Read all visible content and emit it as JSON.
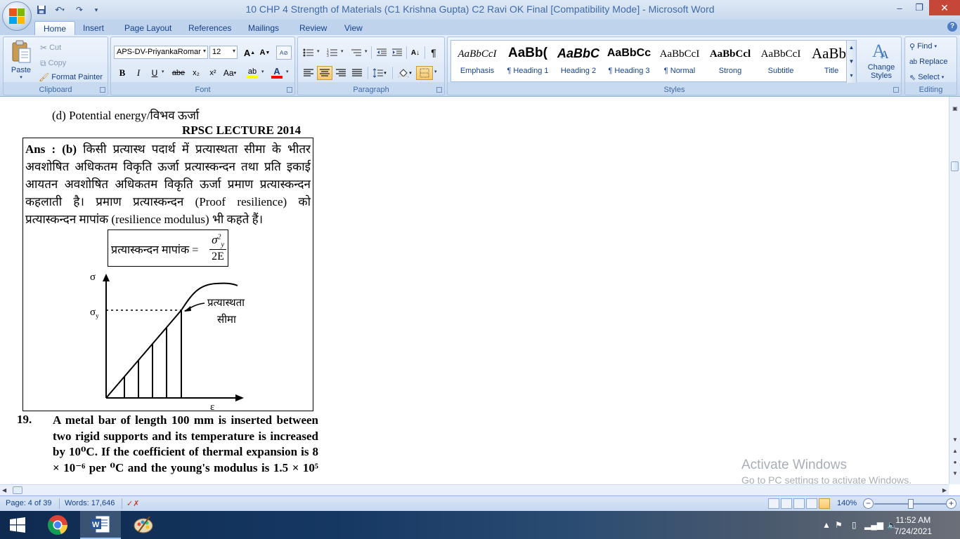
{
  "window": {
    "title": "10 CHP 4 Strength of Materials (C1 Krishna Gupta) C2 Ravi OK Final [Compatibility Mode] - Microsoft Word",
    "minimize": "–",
    "maximize": "❐",
    "close": "✕"
  },
  "tabs": [
    "Home",
    "Insert",
    "Page Layout",
    "References",
    "Mailings",
    "Review",
    "View"
  ],
  "ribbon": {
    "clipboard": {
      "label": "Clipboard",
      "paste": "Paste",
      "cut": "Cut",
      "copy": "Copy",
      "format_painter": "Format Painter"
    },
    "font": {
      "label": "Font",
      "font_name": "APS-DV-PriyankaRomar",
      "font_size": "12",
      "grow": "A",
      "shrink": "A",
      "bold": "B",
      "italic": "I",
      "underline": "U",
      "strike": "abe",
      "subscript": "x₂",
      "superscript": "x²",
      "change_case": "Aa",
      "font_color_letter": "A",
      "highlight_letter": "ab"
    },
    "paragraph": {
      "label": "Paragraph",
      "pilcrow": "¶"
    },
    "styles": {
      "label": "Styles",
      "items": [
        {
          "sample": "AaBbCcI",
          "name": "Emphasis"
        },
        {
          "sample": "AaBb(",
          "name": "¶ Heading 1"
        },
        {
          "sample": "AaBbC",
          "name": "Heading 2"
        },
        {
          "sample": "AaBbCc",
          "name": "¶ Heading 3"
        },
        {
          "sample": "AaBbCcI",
          "name": "¶ Normal"
        },
        {
          "sample": "AaBbCcl",
          "name": "Strong"
        },
        {
          "sample": "AaBbCcI",
          "name": "Subtitle"
        },
        {
          "sample": "AaBb(",
          "name": "Title"
        }
      ],
      "change_styles": "Change Styles"
    },
    "editing": {
      "label": "Editing",
      "find": "Find",
      "replace": "Replace",
      "select": "Select"
    }
  },
  "document": {
    "option_d": "(d)   Potential energy/विभव ऊर्जा",
    "source": "RPSC LECTURE 2014",
    "answer_prefix": "Ans : (b)",
    "answer_text": " किसी प्रत्यास्थ पदार्थ में प्रत्यास्थता सीमा के भीतर अवशोषित अधिकतम विकृति ऊर्जा प्रत्यास्कन्दन तथा प्रति इकाई आयतन अवशोषित अधिकतम विकृति ऊर्जा प्रमाण प्रत्यास्कन्दन कहलाती है। प्रमाण प्रत्यास्कन्दन (Proof resilience) को प्रत्यास्कन्दन मापांक (resilience modulus) भी कहते हैं।",
    "formula_lhs": "प्रत्यास्कन्दन मापांक =",
    "formula_num": "σ",
    "formula_num_sub": "y",
    "formula_num_sup": "2",
    "formula_den": "2E",
    "graph": {
      "y_axis": "σ",
      "x_axis": "ε",
      "sigma_y": "σ",
      "sigma_y_sub": "y",
      "annot_line1": "प्रत्यास्थता",
      "annot_line2": "सीमा"
    },
    "q_number": "19.",
    "q_text": "A metal bar of length 100 mm is inserted between two rigid supports and its temperature is increased by 10⁰C. If the coefficient of thermal expansion is 8 × 10⁻⁶ per ⁰C and the young's modulus is 1.5 × 10⁵"
  },
  "watermark": {
    "line1": "Activate Windows",
    "line2": "Go to PC settings to activate Windows."
  },
  "status": {
    "page": "Page: 4 of 39",
    "words": "Words: 17,646",
    "zoom": "140%"
  },
  "taskbar": {
    "time": "11:52 AM",
    "date": "7/24/2021"
  },
  "colors": {
    "ribbon_blue": "#15428b",
    "highlight_yellow": "#ffff00",
    "font_red": "#ff0000",
    "close_red": "#c7463a"
  }
}
